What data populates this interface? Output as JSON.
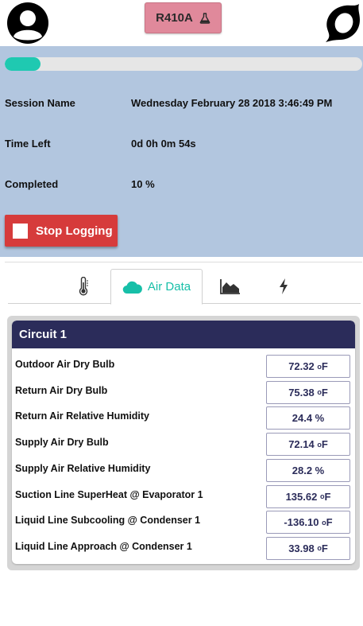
{
  "header": {
    "refrigerant_label": "R410A"
  },
  "session": {
    "progress_percent": 10,
    "name_label": "Session Name",
    "name_value": "Wednesday February 28 2018 3:46:49 PM",
    "time_left_label": "Time Left",
    "time_left_value": "0d 0h 0m 54s",
    "completed_label": "Completed",
    "completed_value": "10 %",
    "stop_button_label": "Stop Logging"
  },
  "tabs": [
    {
      "icon": "thermometer-icon",
      "label": ""
    },
    {
      "icon": "cloud-icon",
      "label": "Air Data",
      "active": true
    },
    {
      "icon": "area-chart-icon",
      "label": ""
    },
    {
      "icon": "lightning-icon",
      "label": ""
    }
  ],
  "circuit": {
    "title": "Circuit 1",
    "readings": [
      {
        "label": "Outdoor Air Dry Bulb",
        "value": "72.32",
        "unit": "F",
        "degree": "o"
      },
      {
        "label": "Return Air Dry Bulb",
        "value": "75.38",
        "unit": "F",
        "degree": "o"
      },
      {
        "label": "Return Air Relative Humidity",
        "value": "24.4 %",
        "unit": "",
        "degree": ""
      },
      {
        "label": "Supply Air Dry Bulb",
        "value": "72.14",
        "unit": "F",
        "degree": "o"
      },
      {
        "label": "Supply Air Relative Humidity",
        "value": "28.2 %",
        "unit": "",
        "degree": ""
      },
      {
        "label": "Suction Line SuperHeat @ Evaporator 1",
        "value": "135.62",
        "unit": "F",
        "degree": "o"
      },
      {
        "label": "Liquid Line Subcooling @ Condenser 1",
        "value": "-136.10",
        "unit": "F",
        "degree": "o"
      },
      {
        "label": "Liquid Line Approach @ Condenser 1",
        "value": "33.98",
        "unit": "F",
        "degree": "o"
      }
    ]
  },
  "colors": {
    "accent": "#1fc9b1",
    "panel": "#b2c6df",
    "stop": "#d63b3b",
    "circuit_header": "#2b2c5a",
    "refrigerant": "#e0899b"
  }
}
